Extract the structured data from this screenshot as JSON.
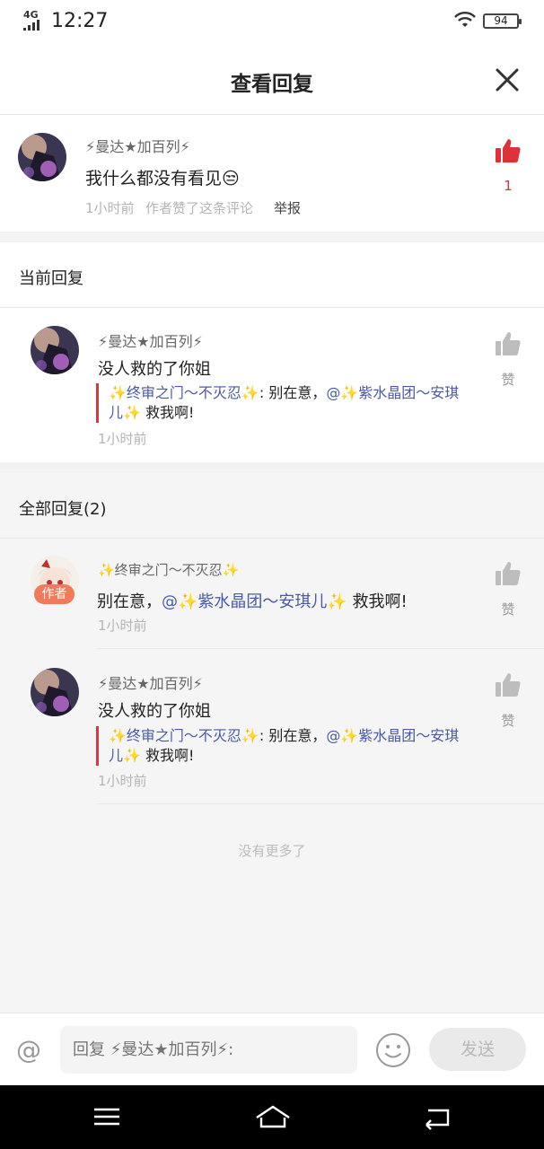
{
  "status_bar": {
    "network": "4G",
    "time": "12:27",
    "battery": "94"
  },
  "header": {
    "title": "查看回复"
  },
  "original_comment": {
    "user": "⚡曼达★加百列⚡",
    "text": "我什么都没有看见😒",
    "time": "1小时前",
    "author_liked": "作者赞了这条评论",
    "report": "举报",
    "like_count": "1"
  },
  "current_reply": {
    "section_title": "当前回复",
    "user": "⚡曼达★加百列⚡",
    "text": "没人救的了你姐",
    "quote_prefix": "✨终审之门～不灭忍✨",
    "quote_body": ": 别在意，",
    "quote_mention": "@✨紫水晶团～安琪儿✨",
    "quote_suffix": " 救我啊!",
    "time": "1小时前",
    "like_label": "赞"
  },
  "all_replies": {
    "section_title": "全部回复(2)",
    "items": [
      {
        "user": "✨终审之门～不灭忍✨",
        "badge": "作者",
        "text_prefix": "别在意，",
        "text_mention": "@✨紫水晶团～安琪儿✨",
        "text_suffix": " 救我啊!",
        "time": "1小时前",
        "like_label": "赞"
      },
      {
        "user": "⚡曼达★加百列⚡",
        "text": "没人救的了你姐",
        "quote_prefix": "✨终审之门～不灭忍✨",
        "quote_body": ": 别在意，",
        "quote_mention": "@✨紫水晶团～安琪儿✨",
        "quote_suffix": " 救我啊!",
        "time": "1小时前",
        "like_label": "赞"
      }
    ],
    "no_more": "没有更多了"
  },
  "composer": {
    "placeholder": "回复 ⚡曼达★加百列⚡:",
    "send_label": "发送"
  },
  "colors": {
    "accent_red": "#e0303a",
    "mention_blue": "#4a5aa6",
    "quote_bar": "#d9363e",
    "author_badge": "#f07a5a"
  }
}
